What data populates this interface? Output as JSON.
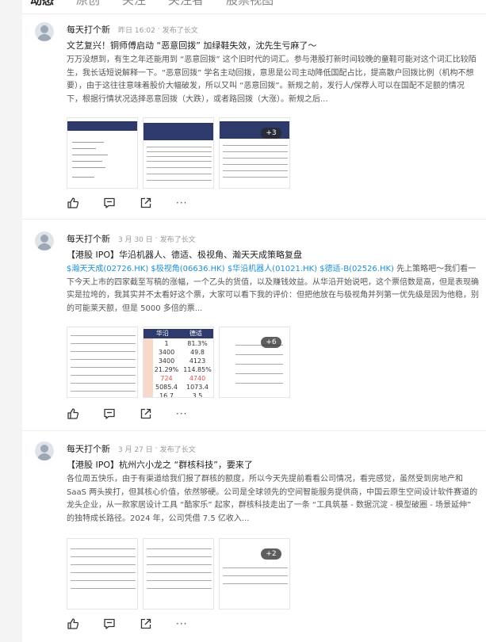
{
  "tabs": [
    {
      "label": "动态",
      "active": true
    },
    {
      "label": "原创",
      "active": false
    },
    {
      "label": "关注",
      "active": false
    },
    {
      "label": "关注者",
      "active": false
    },
    {
      "label": "股票视图",
      "active": false
    }
  ],
  "posts": [
    {
      "author": "每天打个新",
      "time": "昨日 16:02",
      "action": "发布了长文",
      "title": "文艺复兴！铜师傅启动 “恶意回拨” 加绿鞋失效，沈先生亏麻了～",
      "body": "万万没想到，有生之年还能用到 “恶意回拨” 这个旧时代的词汇。参与港股打新时间较晚的童鞋可能对这个词汇比较陌生，我长话短说解释一下。“恶意回拨” 学名主动回拨，意思是公司主动降低国配占比，提高散户回拨比例（机构不想要），由于这往往意味着股价大幅破发，所以又叫 “恶意回拨”。新规之前，发行人/保荐人可以在国配不足额的情况下，根据行情状况选择恶意回拨（大跌），或者路回拨（大涨）。新规之后...",
      "more_count": "+3"
    },
    {
      "author": "每天打个新",
      "time": "3 月 30 日",
      "action": "发布了长文",
      "title": "【港股 IPO】华沿机器人、德适、极视角、瀚天天成策略复盘",
      "stocks": "$瀚天天成(02726.HK)  $极视角(06636.HK)  $华沿机器人(01021.HK)  $德适-B(02526.HK)",
      "body": " 先上策略吧～我们看一下今天上市的四家截至写稿的涨幅，一个乙头的货值，以及赚钱效益。从华沿开始说吧，这个票倍数是高，但是表现确实是拉垮的，我其实并不太看好这个票，大家可以看下我的评价：但把他放在与极视角并列第一优先级是因为他稳，别的可能莱天额，但是 5000 多倍的票...",
      "table_header": [
        "华沿",
        "德适"
      ],
      "table_rows": [
        [
          "1",
          "81.3%"
        ],
        [
          "3400",
          "49.8"
        ],
        [
          "3400",
          "4123"
        ],
        [
          "21.29%",
          "114.85%"
        ],
        [
          "724",
          "4740"
        ],
        [
          "5085.4",
          "1073.4"
        ],
        [
          "16.7",
          "3.5"
        ]
      ],
      "more_count": "+6"
    },
    {
      "author": "每天打个新",
      "time": "3 月 27 日",
      "action": "发布了长文",
      "title": "【港股 IPO】杭州六小龙之 “群核科技”，要来了",
      "body": "各位周五快乐，由于有渠道给我们报了群核的额度，所以今天先提前看看公司情况，看完感觉，虽然受到房地产和 SaaS 两头挨打，但其核心价值，依然够硬。公司是全球领先的空间智能服务提供商，中国云原生空间设计软件赛道的龙头企业，从一款家居设计工具 “酷家乐” 起家，群核科技走出了一条 “工具筑基 - 数据沉淀 - 模型破圈 - 场景延伸” 的独特成长路径。2024 年，公司凭借 7.5 亿收入...",
      "more_count": "+2"
    }
  ],
  "icons": {
    "like": "thumbs-up-icon",
    "comment": "comment-icon",
    "share": "share-icon",
    "more": "more-dots-icon"
  },
  "more_dots": "···",
  "colors": {
    "link": "#1c8fd6",
    "accent": "#2d3a6b",
    "highlight": "#d9534f"
  }
}
